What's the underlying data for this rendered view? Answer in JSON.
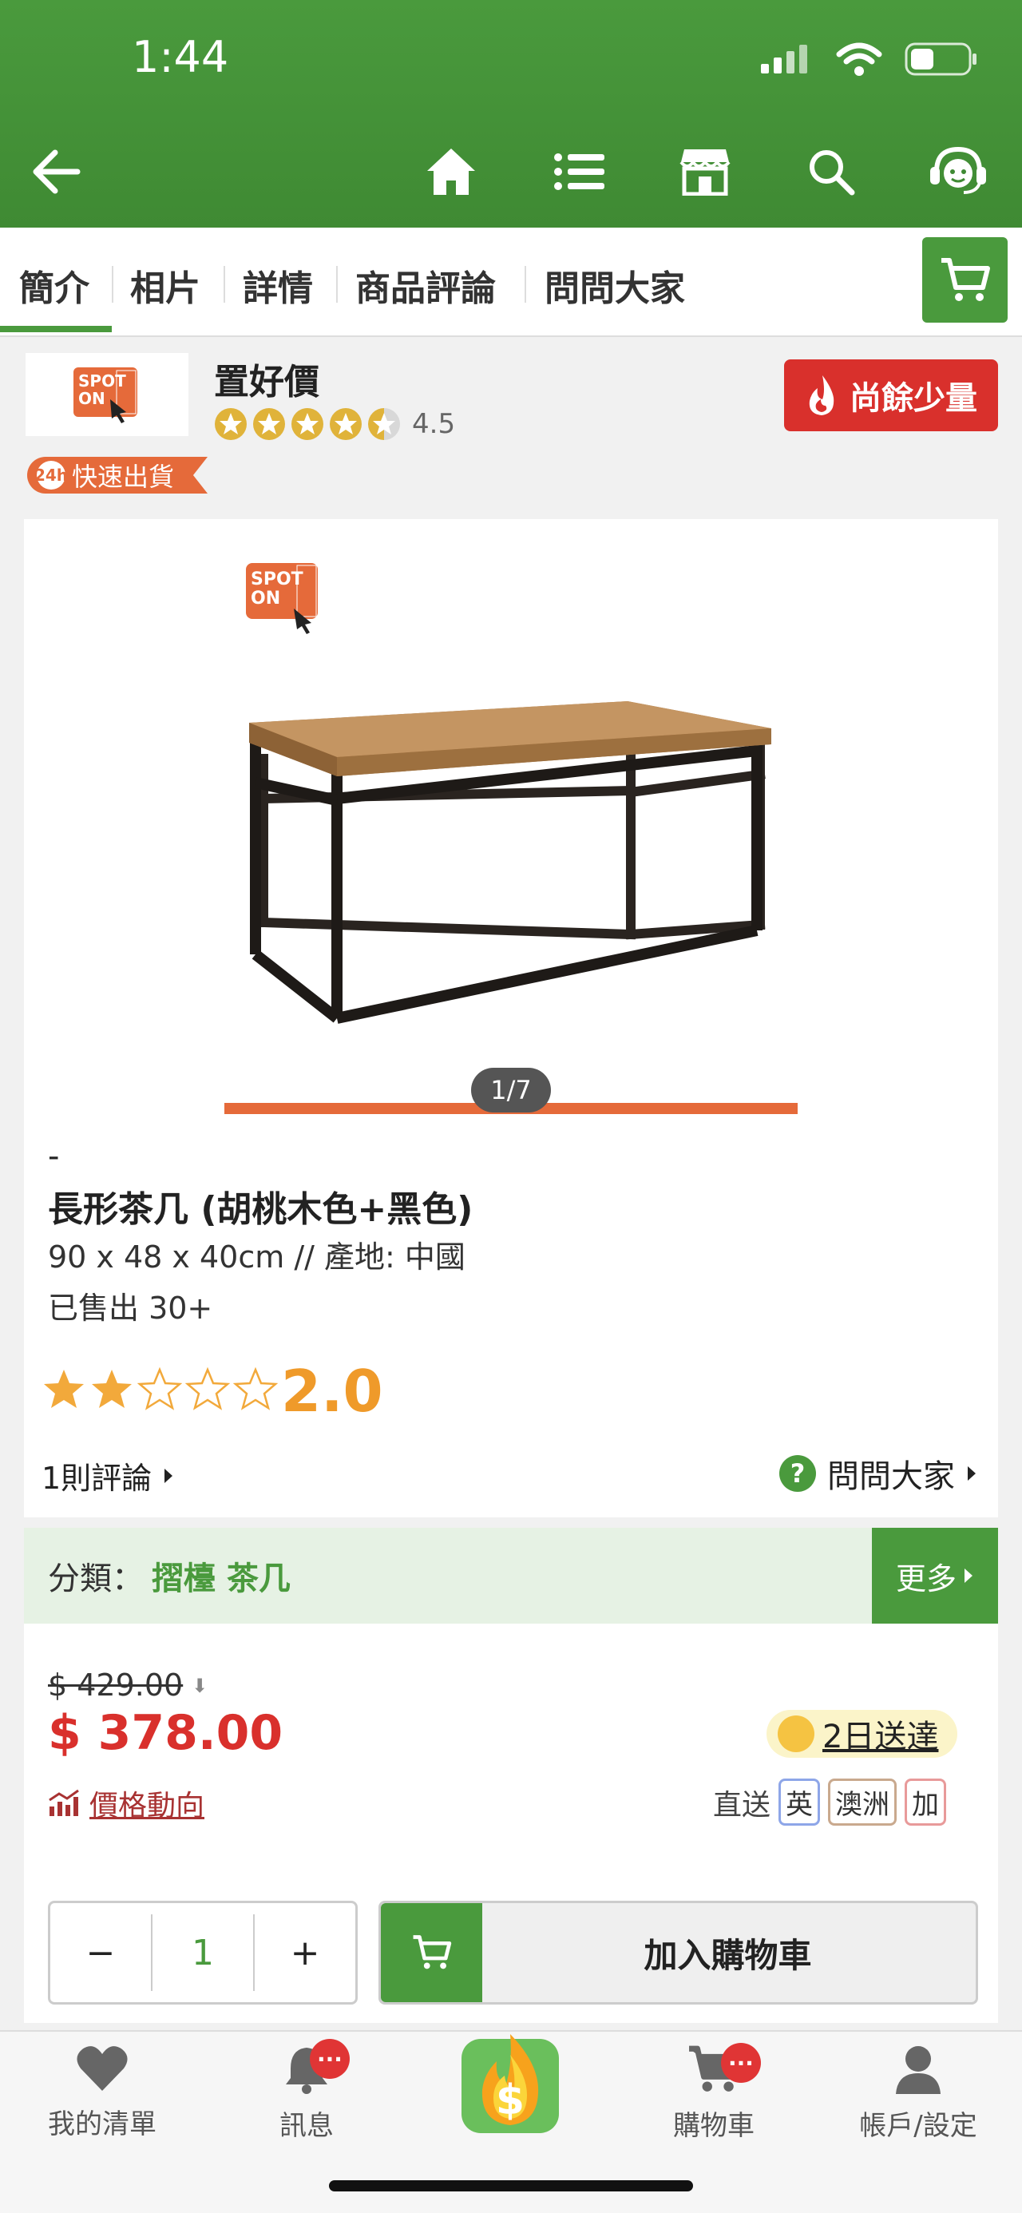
{
  "status_bar": {
    "time": "1:44"
  },
  "tabs": [
    {
      "label": "簡介",
      "active": true
    },
    {
      "label": "相片"
    },
    {
      "label": "詳情"
    },
    {
      "label": "商品評論"
    },
    {
      "label": "問問大家"
    }
  ],
  "seller": {
    "name": "置好價",
    "rating": "4.5",
    "logo_text_1": "SPOT",
    "logo_text_2": "ON",
    "low_stock_label": "尚餘少量",
    "fast_ship_label": "快速出貨",
    "fast_ship_badge": "24h"
  },
  "gallery": {
    "counter": "1/7",
    "current": 1,
    "total": 7
  },
  "product": {
    "dash": "-",
    "title": "長形茶几 (胡桃木色+黑色)",
    "spec": "90 x 48 x 40cm // 產地: 中國",
    "sold": "已售出 30+",
    "rating_score": "2.0",
    "rating_value": 2.0,
    "reviews_link": "1則評論",
    "ask_link": "問問大家"
  },
  "category": {
    "label": "分類：",
    "value": "摺檯 茶几",
    "more": "更多"
  },
  "price": {
    "old": "$ 429.00",
    "new": "$ 378.00",
    "trend_label": "價格動向",
    "delivery": "2日送達",
    "ship_to_label": "直送",
    "regions": [
      {
        "label": "英",
        "color": "#8ea6e8"
      },
      {
        "label": "澳洲",
        "color": "#c9a98e"
      },
      {
        "label": "加",
        "color": "#e89a9a"
      }
    ]
  },
  "purchase": {
    "minus": "−",
    "qty": "1",
    "plus": "+",
    "add_to_cart": "加入購物車"
  },
  "bottom_nav": [
    {
      "label": "我的清單",
      "icon": "heart-icon"
    },
    {
      "label": "訊息",
      "icon": "bell-icon",
      "badge": "···"
    },
    {
      "label": "",
      "icon": "dollar-flame-icon"
    },
    {
      "label": "購物車",
      "icon": "cart-icon",
      "badge": "···"
    },
    {
      "label": "帳戶/設定",
      "icon": "user-icon"
    }
  ],
  "colors": {
    "brand_green": "#4a9a3d",
    "accent_orange": "#e56a3a",
    "price_red": "#d9302c",
    "star_gold": "#ef9a2a"
  }
}
